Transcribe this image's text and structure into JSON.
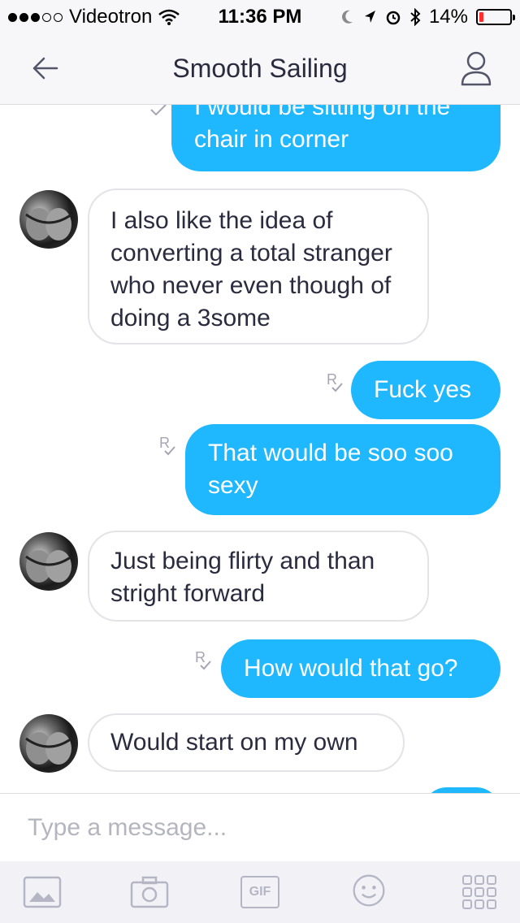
{
  "status_bar": {
    "carrier": "Videotron",
    "time": "11:36 PM",
    "battery": "14%",
    "battery_level": 0.14
  },
  "header": {
    "title": "Smooth Sailing"
  },
  "messages": [
    {
      "direction": "out",
      "text": "I would be sitting on the chair in corner",
      "read_marker": "R"
    },
    {
      "direction": "in",
      "text": "I also like the idea of converting a total stranger who never even though of doing a 3some"
    },
    {
      "direction": "out",
      "text": "Fuck yes",
      "read_marker": "R"
    },
    {
      "direction": "out",
      "text": "That would be soo soo sexy",
      "read_marker": "R"
    },
    {
      "direction": "in",
      "text": "Just being flirty and than stright forward"
    },
    {
      "direction": "out",
      "text": "How would that go?",
      "read_marker": "R"
    },
    {
      "direction": "in",
      "text": "Would start on my own"
    }
  ],
  "composer": {
    "placeholder": "Type a message...",
    "value": ""
  },
  "toolbar": {
    "gif_label": "GIF",
    "icons": [
      "photo-icon",
      "camera-icon",
      "gif-icon",
      "emoji-icon",
      "apps-grid-icon"
    ]
  },
  "colors": {
    "outgoing_bubble": "#1fb8ff",
    "incoming_border": "#e3e3e8",
    "battery_low": "#ff2d2d"
  }
}
